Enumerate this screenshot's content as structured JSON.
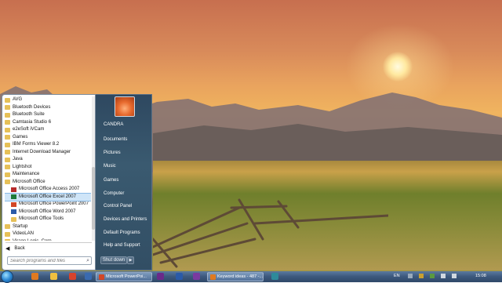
{
  "start_menu": {
    "programs": [
      {
        "label": "AVG",
        "type": "folder",
        "indent": false
      },
      {
        "label": "Bluetooth Devices",
        "type": "folder",
        "indent": false
      },
      {
        "label": "Bluetooth Suite",
        "type": "folder",
        "indent": false
      },
      {
        "label": "Camtasia Studio 6",
        "type": "folder",
        "indent": false
      },
      {
        "label": "e2eSoft iVCam",
        "type": "folder",
        "indent": false
      },
      {
        "label": "Games",
        "type": "folder",
        "indent": false
      },
      {
        "label": "IBM Forms Viewer 8.2",
        "type": "folder",
        "indent": false
      },
      {
        "label": "Internet Download Manager",
        "type": "folder",
        "indent": false
      },
      {
        "label": "Java",
        "type": "folder",
        "indent": false
      },
      {
        "label": "Lightshot",
        "type": "folder",
        "indent": false
      },
      {
        "label": "Maintenance",
        "type": "folder",
        "indent": false
      },
      {
        "label": "Microsoft Office",
        "type": "folder",
        "indent": false
      },
      {
        "label": "Microsoft Office Access 2007",
        "type": "app-access",
        "indent": true
      },
      {
        "label": "Microsoft Office Excel 2007",
        "type": "app-excel",
        "indent": true,
        "highlighted": true
      },
      {
        "label": "Microsoft Office PowerPoint 2007",
        "type": "app-ppt",
        "indent": true
      },
      {
        "label": "Microsoft Office Word 2007",
        "type": "app-word",
        "indent": true
      },
      {
        "label": "Microsoft Office Tools",
        "type": "folder",
        "indent": true
      },
      {
        "label": "Startup",
        "type": "folder",
        "indent": false
      },
      {
        "label": "VideoLAN",
        "type": "folder",
        "indent": false
      },
      {
        "label": "Virage Logic, Corp",
        "type": "folder",
        "indent": false
      }
    ],
    "back_label": "Back",
    "search_placeholder": "Search programs and files",
    "right_links": [
      "CANDRA",
      "Documents",
      "Pictures",
      "Music",
      "Games",
      "Computer",
      "Control Panel",
      "Devices and Printers",
      "Default Programs",
      "Help and Support"
    ],
    "shutdown_label": "Shut down"
  },
  "taskbar": {
    "tasks": [
      {
        "label": "Microsoft PowerPoi..."
      },
      {
        "label": "Keyword ideas - 487 -..."
      }
    ],
    "language": "EN",
    "clock": "15:08"
  }
}
